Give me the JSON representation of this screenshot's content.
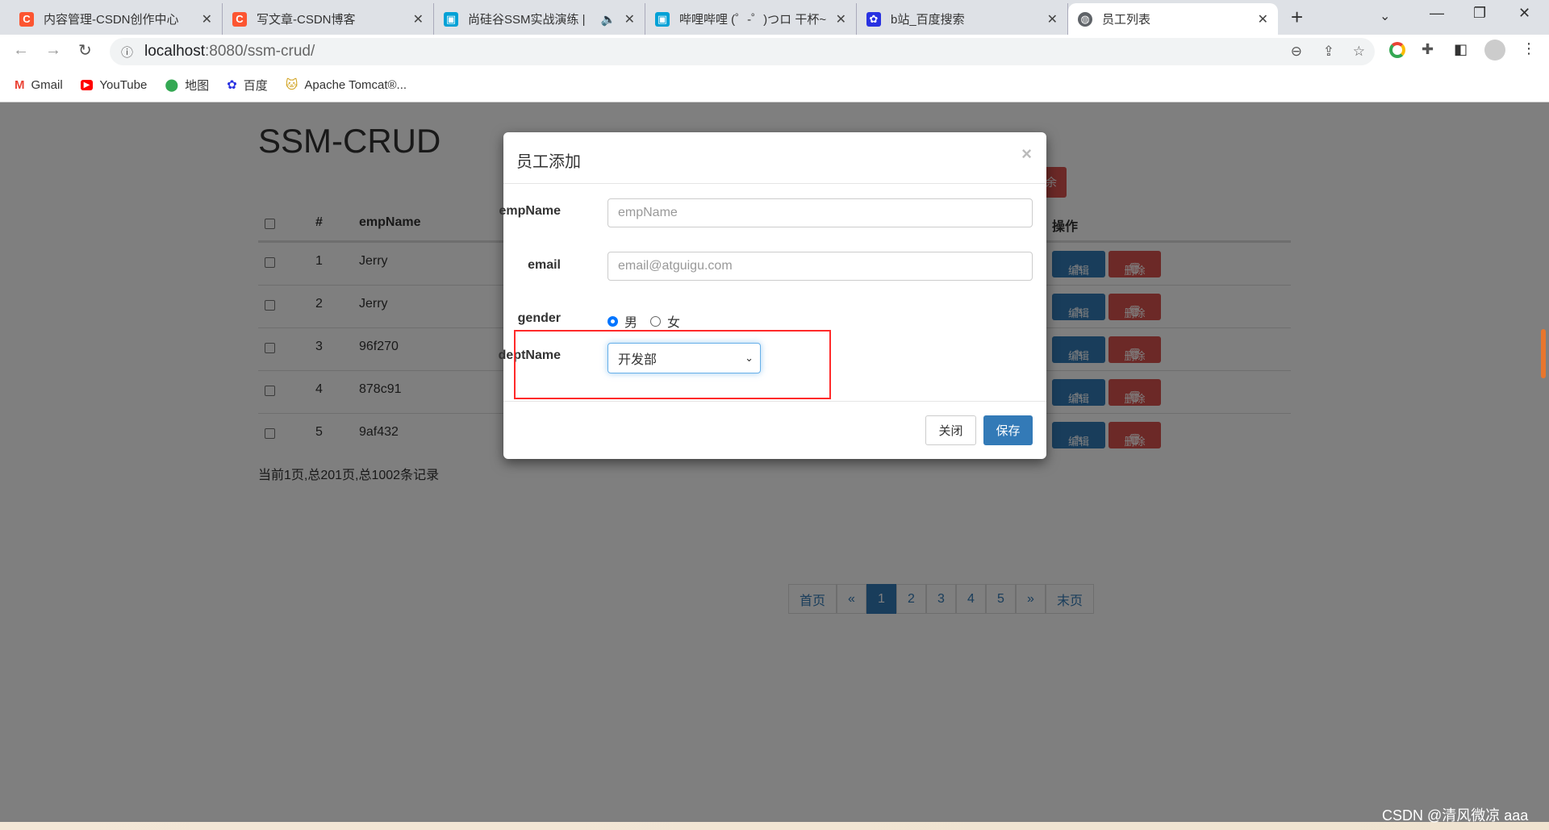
{
  "browser": {
    "tabs": [
      {
        "title": "内容管理-CSDN创作中心",
        "icon": "csdn-icon",
        "color": "#fc5531"
      },
      {
        "title": "写文章-CSDN博客",
        "icon": "csdn-icon",
        "color": "#fc5531"
      },
      {
        "title": "尚硅谷SSM实战演练 | ",
        "icon": "bilibili-icon",
        "color": "#00a1d6"
      },
      {
        "title": "哔哩哔哩 (゜-゜)つロ 干杯~",
        "icon": "bilibili-icon",
        "color": "#00a1d6"
      },
      {
        "title": "b站_百度搜索",
        "icon": "baidu-icon",
        "color": "#2932e1"
      },
      {
        "title": "员工列表",
        "icon": "globe-icon",
        "color": "#5f6368"
      }
    ],
    "url_host": "localhost",
    "url_rest": ":8080/ssm-crud/",
    "bookmarks": [
      {
        "label": "Gmail",
        "icon": "gmail-icon"
      },
      {
        "label": "YouTube",
        "icon": "youtube-icon"
      },
      {
        "label": "地图",
        "icon": "maps-icon"
      },
      {
        "label": "百度",
        "icon": "baidu-icon"
      },
      {
        "label": "Apache Tomcat®...",
        "icon": "tomcat-icon"
      }
    ]
  },
  "page": {
    "title": "SSM-CRUD",
    "columns": {
      "num": "#",
      "name": "empName",
      "ops": "操作"
    },
    "rows": [
      {
        "id": "1",
        "name": "Jerry"
      },
      {
        "id": "2",
        "name": "Jerry"
      },
      {
        "id": "3",
        "name": "96f270"
      },
      {
        "id": "4",
        "name": "878c91"
      },
      {
        "id": "5",
        "name": "9af432"
      }
    ],
    "edit_label": "编辑",
    "delete_label": "删除",
    "top_delete_label": "余",
    "page_info": "当前1页,总201页,总1002条记录",
    "pagination": [
      "首页",
      "«",
      "1",
      "2",
      "3",
      "4",
      "5",
      "»",
      "末页"
    ],
    "current_page": "1"
  },
  "modal": {
    "title": "员工添加",
    "close_x": "×",
    "fields": {
      "empName_label": "empName",
      "empName_placeholder": "empName",
      "email_label": "email",
      "email_placeholder": "email@atguigu.com",
      "gender_label": "gender",
      "male": "男",
      "female": "女",
      "gender_selected": "男",
      "dept_label": "deptName",
      "dept_value": "开发部"
    },
    "close_button": "关闭",
    "save_button": "保存"
  },
  "watermark": "CSDN @清风微凉 aaa",
  "colors": {
    "primary": "#337ab7",
    "danger": "#d9534f",
    "highlight": "#ff2a2a"
  }
}
